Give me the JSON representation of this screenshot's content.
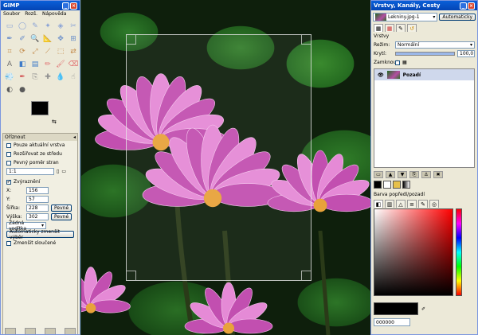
{
  "toolbox": {
    "title": "GIMP",
    "menu": [
      "Soubor",
      "Rozš.",
      "Nápověda"
    ],
    "tool_icons": [
      "rect-select-icon",
      "ellipse-select-icon",
      "free-select-icon",
      "fuzzy-select-icon",
      "color-select-icon",
      "scissors-icon",
      "paths-icon",
      "color-picker-icon",
      "zoom-icon",
      "measure-icon",
      "move-icon",
      "align-icon",
      "crop-icon",
      "rotate-icon",
      "scale-icon",
      "shear-icon",
      "perspective-icon",
      "flip-icon",
      "text-icon",
      "bucket-fill-icon",
      "blend-icon",
      "pencil-icon",
      "brush-icon",
      "eraser-icon",
      "airbrush-icon",
      "ink-icon",
      "clone-icon",
      "heal-icon",
      "blur-icon",
      "smudge-icon",
      "dodge-icon",
      "burn-icon"
    ],
    "tool_glyphs": [
      "▭",
      "◯",
      "✎",
      "✦",
      "◈",
      "✂",
      "✒",
      "✐",
      "🔍",
      "📐",
      "✥",
      "⊞",
      "⌗",
      "⟳",
      "⤢",
      "⟋",
      "⬚",
      "⇄",
      "A",
      "◧",
      "▤",
      "✏",
      "🖌",
      "⌫",
      "💨",
      "✒",
      "⎘",
      "✚",
      "💧",
      "☝",
      "◐",
      "●"
    ],
    "tool_colors": [
      "#8aa3d6",
      "#8aa3d6",
      "#8aa3d6",
      "#8aa3d6",
      "#8aa3d6",
      "#8aa3d6",
      "#6b8fca",
      "#6b8fca",
      "#6b8fca",
      "#6b8fca",
      "#6b8fca",
      "#6b8fca",
      "#c38a4a",
      "#c38a4a",
      "#c38a4a",
      "#c38a4a",
      "#c38a4a",
      "#c38a4a",
      "#6e6e6e",
      "#3e7bc8",
      "#3e7bc8",
      "#e07070",
      "#e07070",
      "#e07070",
      "#d25555",
      "#d25555",
      "#8e8e8e",
      "#8e8e8e",
      "#8e8e8e",
      "#8e8e8e",
      "#5a5a5a",
      "#5a5a5a"
    ]
  },
  "options": {
    "title": "Oříznout",
    "current_layer_only": "Pouze aktuální vrstva",
    "expand_center": "Rozšiřovat ze středu",
    "fixed_ratio": "Pevný poměr stran",
    "ratio_value": "1:1",
    "highlight": "Zvýraznění",
    "x_label": "X:",
    "x_value": "156",
    "y_label": "Y:",
    "y_value": "57",
    "width_label": "Šířka:",
    "width_value": "228",
    "height_label": "Výška:",
    "height_value": "302",
    "fixed_label": "Pevné",
    "guide_select": "Žádná vodítka",
    "auto_shrink": "Automaticky zmenšit výběr",
    "shrink_merged": "Zmenšit sloučené"
  },
  "dock": {
    "title": "Vrstvy, Kanály, Cesty",
    "image_name": "Lekniny.jpg-1",
    "auto_button": "Automaticky",
    "layers_heading": "Vrstvy",
    "mode_label": "Režim:",
    "mode_value": "Normální",
    "opacity_label": "Krytí:",
    "opacity_value": "100,0",
    "opacity_fraction": 1.0,
    "lock_label": "Zamknout:",
    "layer_name": "Pozadí",
    "fgbg_title": "Barva popředí/pozadí",
    "hex_value": "000000",
    "hue_marker": 0.5
  },
  "colors": {
    "titlebar": "#0445b5",
    "panel_bg": "#ece9d8",
    "foreground": "#000000",
    "background": "#ffffff",
    "flower_pink": "#c24fb0"
  }
}
